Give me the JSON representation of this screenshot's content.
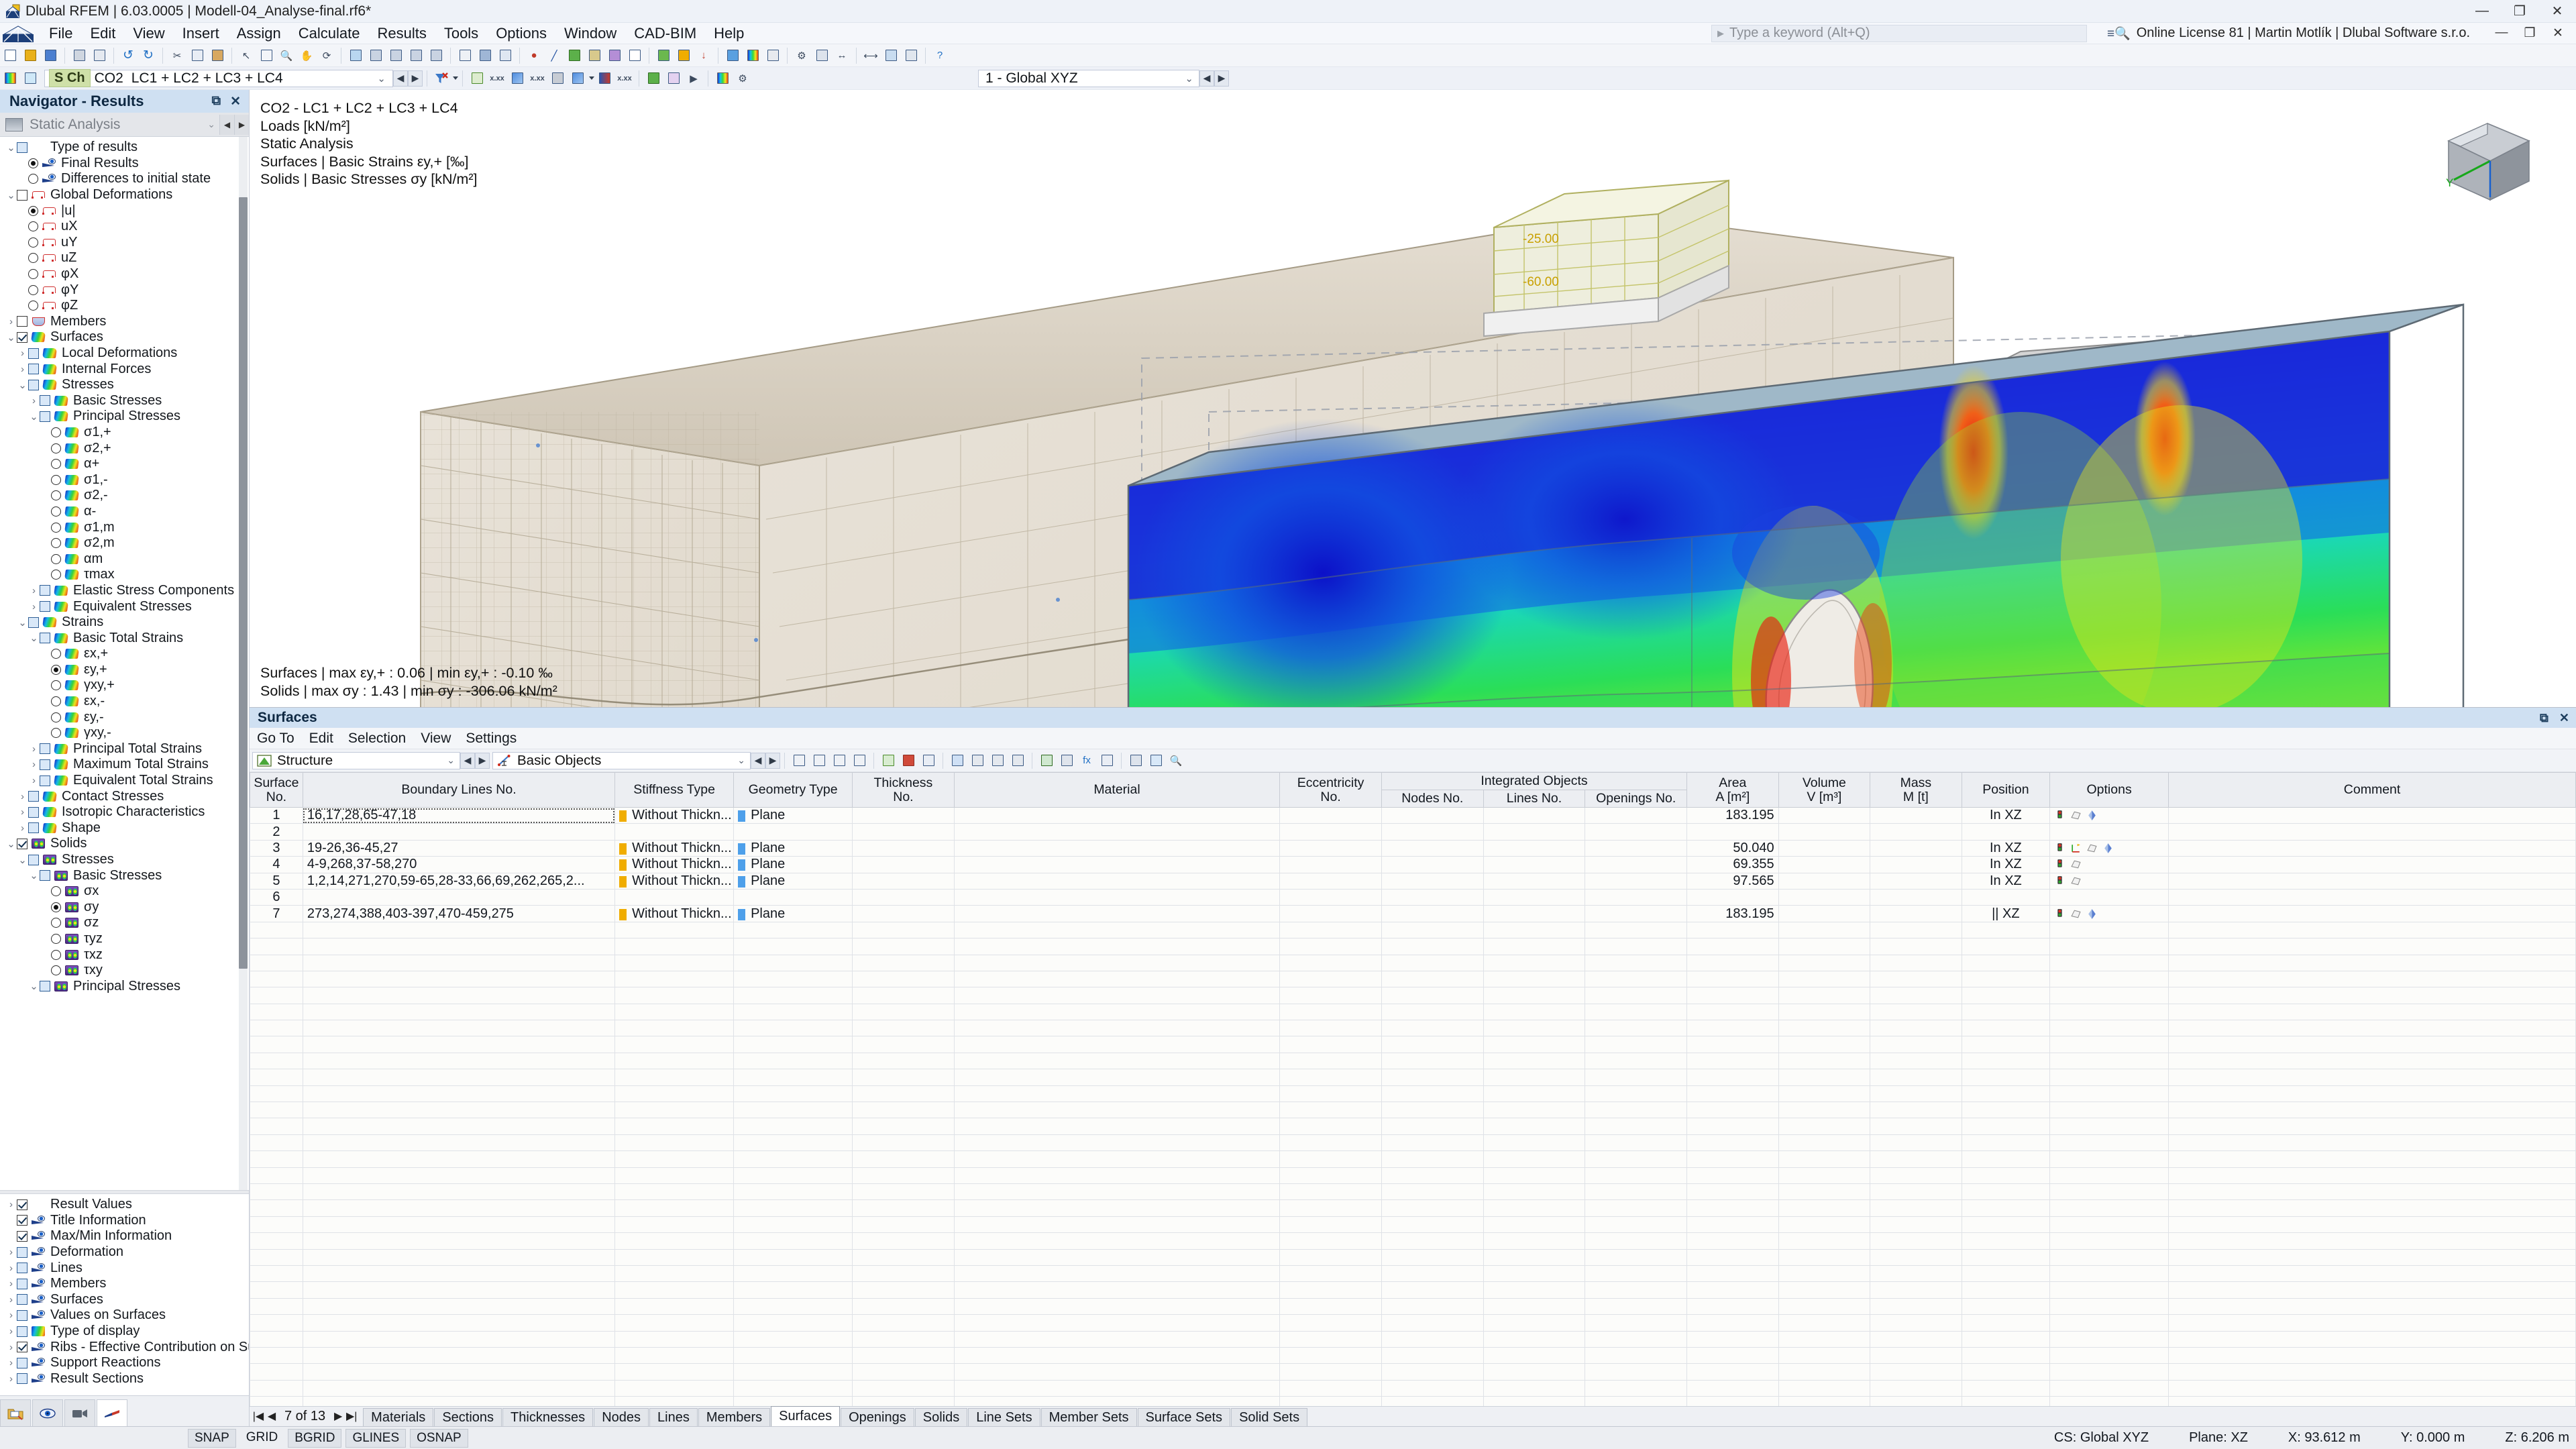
{
  "titlebar": {
    "title": "Dlubal RFEM | 6.03.0005 | Modell-04_Analyse-final.rf6*",
    "minimize": "—",
    "maximize": "❐",
    "close": "✕"
  },
  "menubar": {
    "items": [
      "File",
      "Edit",
      "View",
      "Insert",
      "Assign",
      "Calculate",
      "Results",
      "Tools",
      "Options",
      "Window",
      "CAD-BIM",
      "Help"
    ],
    "keyword_placeholder": "Type a keyword (Alt+Q)",
    "license": "Online License 81 | Martin Motlík | Dlubal Software s.r.o.",
    "min": "—",
    "restore": "❐",
    "close": "✕"
  },
  "toolbar": {
    "load_case_tag": "S Ch",
    "load_case_id": "CO2",
    "load_case_text": "LC1 + LC2 + LC3 + LC4",
    "view_combo": "1 - Global XYZ"
  },
  "navigator": {
    "title": "Navigator - Results",
    "analysis_select": "Static Analysis",
    "tree": [
      {
        "indent": 0,
        "twisty": "v",
        "ctrl": "cb",
        "checked": false,
        "icon": "none",
        "label": "Type of results"
      },
      {
        "indent": 1,
        "twisty": "",
        "ctrl": "rb",
        "checked": true,
        "icon": "eye",
        "label": "Final Results"
      },
      {
        "indent": 1,
        "twisty": "",
        "ctrl": "rb",
        "checked": false,
        "icon": "eye",
        "label": "Differences to initial state"
      },
      {
        "indent": 0,
        "twisty": "v",
        "ctrl": "cb-plain",
        "checked": false,
        "icon": "def",
        "label": "Global Deformations"
      },
      {
        "indent": 1,
        "twisty": "",
        "ctrl": "rb",
        "checked": true,
        "icon": "def",
        "label": "|u|"
      },
      {
        "indent": 1,
        "twisty": "",
        "ctrl": "rb",
        "checked": false,
        "icon": "def",
        "label": "uX"
      },
      {
        "indent": 1,
        "twisty": "",
        "ctrl": "rb",
        "checked": false,
        "icon": "def",
        "label": "uY"
      },
      {
        "indent": 1,
        "twisty": "",
        "ctrl": "rb",
        "checked": false,
        "icon": "def",
        "label": "uZ"
      },
      {
        "indent": 1,
        "twisty": "",
        "ctrl": "rb",
        "checked": false,
        "icon": "def",
        "label": "φX"
      },
      {
        "indent": 1,
        "twisty": "",
        "ctrl": "rb",
        "checked": false,
        "icon": "def",
        "label": "φY"
      },
      {
        "indent": 1,
        "twisty": "",
        "ctrl": "rb",
        "checked": false,
        "icon": "def",
        "label": "φZ"
      },
      {
        "indent": 0,
        "twisty": ">",
        "ctrl": "cb-plain",
        "checked": false,
        "icon": "mem",
        "label": "Members"
      },
      {
        "indent": 0,
        "twisty": "v",
        "ctrl": "cb-plain",
        "checked": true,
        "icon": "surf",
        "label": "Surfaces"
      },
      {
        "indent": 1,
        "twisty": ">",
        "ctrl": "cb",
        "checked": false,
        "icon": "surf",
        "label": "Local Deformations"
      },
      {
        "indent": 1,
        "twisty": ">",
        "ctrl": "cb",
        "checked": false,
        "icon": "surf",
        "label": "Internal Forces"
      },
      {
        "indent": 1,
        "twisty": "v",
        "ctrl": "cb",
        "checked": false,
        "icon": "surf",
        "label": "Stresses"
      },
      {
        "indent": 2,
        "twisty": ">",
        "ctrl": "cb",
        "checked": false,
        "icon": "surf",
        "label": "Basic Stresses"
      },
      {
        "indent": 2,
        "twisty": "v",
        "ctrl": "cb",
        "checked": false,
        "icon": "surf",
        "label": "Principal Stresses"
      },
      {
        "indent": 3,
        "twisty": "",
        "ctrl": "rb",
        "checked": false,
        "icon": "surf",
        "label": "σ1,+"
      },
      {
        "indent": 3,
        "twisty": "",
        "ctrl": "rb",
        "checked": false,
        "icon": "surf",
        "label": "σ2,+"
      },
      {
        "indent": 3,
        "twisty": "",
        "ctrl": "rb",
        "checked": false,
        "icon": "surf",
        "label": "α+"
      },
      {
        "indent": 3,
        "twisty": "",
        "ctrl": "rb",
        "checked": false,
        "icon": "surf",
        "label": "σ1,-"
      },
      {
        "indent": 3,
        "twisty": "",
        "ctrl": "rb",
        "checked": false,
        "icon": "surf",
        "label": "σ2,-"
      },
      {
        "indent": 3,
        "twisty": "",
        "ctrl": "rb",
        "checked": false,
        "icon": "surf",
        "label": "α-"
      },
      {
        "indent": 3,
        "twisty": "",
        "ctrl": "rb",
        "checked": false,
        "icon": "surf",
        "label": "σ1,m"
      },
      {
        "indent": 3,
        "twisty": "",
        "ctrl": "rb",
        "checked": false,
        "icon": "surf",
        "label": "σ2,m"
      },
      {
        "indent": 3,
        "twisty": "",
        "ctrl": "rb",
        "checked": false,
        "icon": "surf",
        "label": "αm"
      },
      {
        "indent": 3,
        "twisty": "",
        "ctrl": "rb",
        "checked": false,
        "icon": "surf",
        "label": "τmax"
      },
      {
        "indent": 2,
        "twisty": ">",
        "ctrl": "cb",
        "checked": false,
        "icon": "surf",
        "label": "Elastic Stress Components"
      },
      {
        "indent": 2,
        "twisty": ">",
        "ctrl": "cb",
        "checked": false,
        "icon": "surf",
        "label": "Equivalent Stresses"
      },
      {
        "indent": 1,
        "twisty": "v",
        "ctrl": "cb",
        "checked": false,
        "icon": "surf",
        "label": "Strains"
      },
      {
        "indent": 2,
        "twisty": "v",
        "ctrl": "cb",
        "checked": false,
        "icon": "surf",
        "label": "Basic Total Strains"
      },
      {
        "indent": 3,
        "twisty": "",
        "ctrl": "rb",
        "checked": false,
        "icon": "surf",
        "label": "εx,+"
      },
      {
        "indent": 3,
        "twisty": "",
        "ctrl": "rb",
        "checked": true,
        "icon": "surf",
        "label": "εy,+"
      },
      {
        "indent": 3,
        "twisty": "",
        "ctrl": "rb",
        "checked": false,
        "icon": "surf",
        "label": "γxy,+"
      },
      {
        "indent": 3,
        "twisty": "",
        "ctrl": "rb",
        "checked": false,
        "icon": "surf",
        "label": "εx,-"
      },
      {
        "indent": 3,
        "twisty": "",
        "ctrl": "rb",
        "checked": false,
        "icon": "surf",
        "label": "εy,-"
      },
      {
        "indent": 3,
        "twisty": "",
        "ctrl": "rb",
        "checked": false,
        "icon": "surf",
        "label": "γxy,-"
      },
      {
        "indent": 2,
        "twisty": ">",
        "ctrl": "cb",
        "checked": false,
        "icon": "surf",
        "label": "Principal Total Strains"
      },
      {
        "indent": 2,
        "twisty": ">",
        "ctrl": "cb",
        "checked": false,
        "icon": "surf",
        "label": "Maximum Total Strains"
      },
      {
        "indent": 2,
        "twisty": ">",
        "ctrl": "cb",
        "checked": false,
        "icon": "surf",
        "label": "Equivalent Total Strains"
      },
      {
        "indent": 1,
        "twisty": ">",
        "ctrl": "cb",
        "checked": false,
        "icon": "surf",
        "label": "Contact Stresses"
      },
      {
        "indent": 1,
        "twisty": ">",
        "ctrl": "cb",
        "checked": false,
        "icon": "surf",
        "label": "Isotropic Characteristics"
      },
      {
        "indent": 1,
        "twisty": ">",
        "ctrl": "cb",
        "checked": false,
        "icon": "surf",
        "label": "Shape"
      },
      {
        "indent": 0,
        "twisty": "v",
        "ctrl": "cb-plain",
        "checked": true,
        "icon": "solid",
        "label": "Solids"
      },
      {
        "indent": 1,
        "twisty": "v",
        "ctrl": "cb",
        "checked": false,
        "icon": "solid",
        "label": "Stresses"
      },
      {
        "indent": 2,
        "twisty": "v",
        "ctrl": "cb",
        "checked": false,
        "icon": "solid",
        "label": "Basic Stresses"
      },
      {
        "indent": 3,
        "twisty": "",
        "ctrl": "rb",
        "checked": false,
        "icon": "solid",
        "label": "σx"
      },
      {
        "indent": 3,
        "twisty": "",
        "ctrl": "rb",
        "checked": true,
        "icon": "solid",
        "label": "σy"
      },
      {
        "indent": 3,
        "twisty": "",
        "ctrl": "rb",
        "checked": false,
        "icon": "solid",
        "label": "σz"
      },
      {
        "indent": 3,
        "twisty": "",
        "ctrl": "rb",
        "checked": false,
        "icon": "solid",
        "label": "τyz"
      },
      {
        "indent": 3,
        "twisty": "",
        "ctrl": "rb",
        "checked": false,
        "icon": "solid",
        "label": "τxz"
      },
      {
        "indent": 3,
        "twisty": "",
        "ctrl": "rb",
        "checked": false,
        "icon": "solid",
        "label": "τxy"
      },
      {
        "indent": 2,
        "twisty": "v",
        "ctrl": "cb",
        "checked": false,
        "icon": "solid",
        "label": "Principal Stresses"
      }
    ],
    "tree_bottom": [
      {
        "indent": 0,
        "twisty": ">",
        "ctrl": "cb-plain",
        "checked": true,
        "icon": "xxx",
        "label": "Result Values"
      },
      {
        "indent": 0,
        "twisty": "",
        "ctrl": "cb-plain",
        "checked": true,
        "icon": "eye",
        "label": "Title Information"
      },
      {
        "indent": 0,
        "twisty": "",
        "ctrl": "cb-plain",
        "checked": true,
        "icon": "eye",
        "label": "Max/Min Information"
      },
      {
        "indent": 0,
        "twisty": ">",
        "ctrl": "cb",
        "checked": false,
        "icon": "eye",
        "label": "Deformation"
      },
      {
        "indent": 0,
        "twisty": ">",
        "ctrl": "cb",
        "checked": false,
        "icon": "eye",
        "label": "Lines"
      },
      {
        "indent": 0,
        "twisty": ">",
        "ctrl": "cb",
        "checked": false,
        "icon": "eye",
        "label": "Members"
      },
      {
        "indent": 0,
        "twisty": ">",
        "ctrl": "cb",
        "checked": false,
        "icon": "eye",
        "label": "Surfaces"
      },
      {
        "indent": 0,
        "twisty": ">",
        "ctrl": "cb",
        "checked": false,
        "icon": "eye",
        "label": "Values on Surfaces"
      },
      {
        "indent": 0,
        "twisty": ">",
        "ctrl": "cb",
        "checked": false,
        "icon": "grad",
        "label": "Type of display"
      },
      {
        "indent": 0,
        "twisty": ">",
        "ctrl": "cb-plain",
        "checked": true,
        "icon": "eye",
        "label": "Ribs - Effective Contribution on Surface..."
      },
      {
        "indent": 0,
        "twisty": ">",
        "ctrl": "cb",
        "checked": false,
        "icon": "eye",
        "label": "Support Reactions"
      },
      {
        "indent": 0,
        "twisty": ">",
        "ctrl": "cb",
        "checked": false,
        "icon": "eye",
        "label": "Result Sections"
      }
    ]
  },
  "viewport": {
    "info_lines": [
      "CO2 - LC1 + LC2 + LC3 + LC4",
      "Loads [kN/m²]",
      "Static Analysis",
      "Surfaces | Basic Strains εy,+ [‰]",
      "Solids | Basic Stresses σy [kN/m²]"
    ],
    "maxmin_lines": [
      "Surfaces | max εy,+ : 0.06 | min εy,+ : -0.10 ‰",
      "Solids | max σy : 1.43 | min σy : -306.06 kN/m²"
    ],
    "load_labels": [
      "-25.00",
      "-60.00"
    ],
    "axis_labels": {
      "y": "Y",
      "x": "X",
      "z": "Z"
    }
  },
  "table_panel": {
    "title": "Surfaces",
    "menu": [
      "Go To",
      "Edit",
      "Selection",
      "View",
      "Settings"
    ],
    "combo_left": "Structure",
    "combo_right": "Basic Objects",
    "columns": {
      "surface_no": [
        "Surface",
        "No."
      ],
      "boundary_lines": [
        "",
        "Boundary Lines No."
      ],
      "stiffness_type": [
        "",
        "Stiffness Type"
      ],
      "geometry_type": [
        "",
        "Geometry Type"
      ],
      "thickness": [
        "Thickness",
        "No."
      ],
      "material": [
        "",
        "Material"
      ],
      "eccentricity": [
        "Eccentricity",
        "No."
      ],
      "integrated_objects": "Integrated Objects",
      "nodes_no": "Nodes No.",
      "lines_no": "Lines No.",
      "openings_no": "Openings No.",
      "area": [
        "Area",
        "A [m²]"
      ],
      "volume": [
        "Volume",
        "V [m³]"
      ],
      "mass": [
        "Mass",
        "M [t]"
      ],
      "position": [
        "",
        "Position"
      ],
      "options": [
        "",
        "Options"
      ],
      "comment": [
        "",
        "Comment"
      ]
    },
    "rows": [
      {
        "no": "1",
        "boundary": "16,17,28,65-47,18",
        "stiffness": "Without Thickn...",
        "geometry": "Plane",
        "thickness": "",
        "material": "",
        "ecc": "",
        "nodes": "",
        "lines": "",
        "openings": "",
        "area": "183.195",
        "volume": "",
        "mass": "",
        "position": "In XZ",
        "options": 3,
        "comment": "",
        "selected": true
      },
      {
        "no": "2",
        "boundary": "",
        "stiffness": "",
        "geometry": "",
        "thickness": "",
        "material": "",
        "ecc": "",
        "nodes": "",
        "lines": "",
        "openings": "",
        "area": "",
        "volume": "",
        "mass": "",
        "position": "",
        "options": 0,
        "comment": "",
        "blank": true
      },
      {
        "no": "3",
        "boundary": "19-26,36-45,27",
        "stiffness": "Without Thickn...",
        "geometry": "Plane",
        "thickness": "",
        "material": "",
        "ecc": "",
        "nodes": "",
        "lines": "",
        "openings": "",
        "area": "50.040",
        "volume": "",
        "mass": "",
        "position": "In XZ",
        "options": 4,
        "comment": ""
      },
      {
        "no": "4",
        "boundary": "4-9,268,37-58,270",
        "stiffness": "Without Thickn...",
        "geometry": "Plane",
        "thickness": "",
        "material": "",
        "ecc": "",
        "nodes": "",
        "lines": "",
        "openings": "",
        "area": "69.355",
        "volume": "",
        "mass": "",
        "position": "In XZ",
        "options": 2,
        "comment": ""
      },
      {
        "no": "5",
        "boundary": "1,2,14,271,270,59-65,28-33,66,69,262,265,2...",
        "stiffness": "Without Thickn...",
        "geometry": "Plane",
        "thickness": "",
        "material": "",
        "ecc": "",
        "nodes": "",
        "lines": "",
        "openings": "",
        "area": "97.565",
        "volume": "",
        "mass": "",
        "position": "In XZ",
        "options": 2,
        "comment": ""
      },
      {
        "no": "6",
        "boundary": "",
        "stiffness": "",
        "geometry": "",
        "thickness": "",
        "material": "",
        "ecc": "",
        "nodes": "",
        "lines": "",
        "openings": "",
        "area": "",
        "volume": "",
        "mass": "",
        "position": "",
        "options": 0,
        "comment": "",
        "blank": true
      },
      {
        "no": "7",
        "boundary": "273,274,388,403-397,470-459,275",
        "stiffness": "Without Thickn...",
        "geometry": "Plane",
        "thickness": "",
        "material": "",
        "ecc": "",
        "nodes": "",
        "lines": "",
        "openings": "",
        "area": "183.195",
        "volume": "",
        "mass": "",
        "position": "|| XZ",
        "options": 3,
        "comment": ""
      }
    ],
    "pager": "7 of 13",
    "tabs": [
      "Materials",
      "Sections",
      "Thicknesses",
      "Nodes",
      "Lines",
      "Members",
      "Surfaces",
      "Openings",
      "Solids",
      "Line Sets",
      "Member Sets",
      "Surface Sets",
      "Solid Sets"
    ],
    "active_tab": "Surfaces"
  },
  "status_bar": {
    "buttons": [
      {
        "label": "SNAP",
        "on": true
      },
      {
        "label": "GRID",
        "on": false
      },
      {
        "label": "BGRID",
        "on": true
      },
      {
        "label": "GLINES",
        "on": true
      },
      {
        "label": "OSNAP",
        "on": true
      }
    ],
    "cs": "CS: Global XYZ",
    "plane": "Plane: XZ",
    "x": "X: 93.612 m",
    "y": "Y: 0.000 m",
    "z": "Z: 6.206 m"
  }
}
